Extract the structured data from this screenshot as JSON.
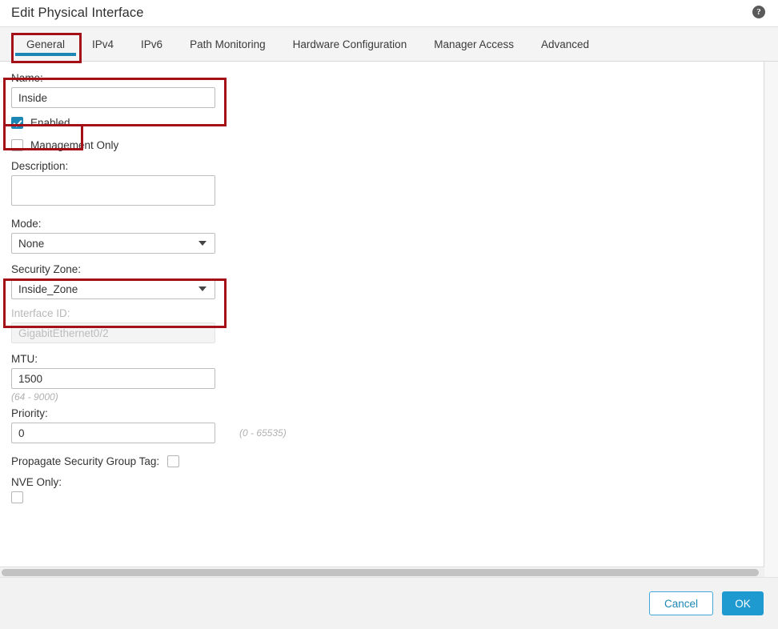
{
  "dialog": {
    "title": "Edit Physical Interface",
    "help_icon": "help-circle-icon"
  },
  "tabs": [
    {
      "label": "General",
      "active": true
    },
    {
      "label": "IPv4",
      "active": false
    },
    {
      "label": "IPv6",
      "active": false
    },
    {
      "label": "Path Monitoring",
      "active": false
    },
    {
      "label": "Hardware Configuration",
      "active": false
    },
    {
      "label": "Manager Access",
      "active": false
    },
    {
      "label": "Advanced",
      "active": false
    }
  ],
  "form": {
    "name": {
      "label": "Name:",
      "value": "Inside",
      "placeholder": ""
    },
    "enabled": {
      "label": "Enabled",
      "checked": true
    },
    "management_only": {
      "label": "Management Only",
      "checked": false
    },
    "description": {
      "label": "Description:",
      "value": "",
      "placeholder": ""
    },
    "mode": {
      "label": "Mode:",
      "value": "None"
    },
    "security_zone": {
      "label": "Security Zone:",
      "value": "Inside_Zone"
    },
    "interface_id": {
      "label": "Interface ID:",
      "value": "GigabitEthernet0/2",
      "disabled": true
    },
    "mtu": {
      "label": "MTU:",
      "value": "1500",
      "hint": "(64 - 9000)"
    },
    "priority": {
      "label": "Priority:",
      "value": "0",
      "hint": "(0 - 65535)"
    },
    "propagate_sgt": {
      "label": "Propagate Security Group Tag:",
      "checked": false
    },
    "nve_only": {
      "label": "NVE Only:",
      "checked": false
    }
  },
  "footer": {
    "cancel_label": "Cancel",
    "ok_label": "OK"
  },
  "colors": {
    "accent_blue": "#1c87b5",
    "ok_button": "#1e9ad1",
    "annotation_red": "#a41018",
    "tabbar_background": "#f4f4f4",
    "footer_background": "#f2f2f2"
  }
}
